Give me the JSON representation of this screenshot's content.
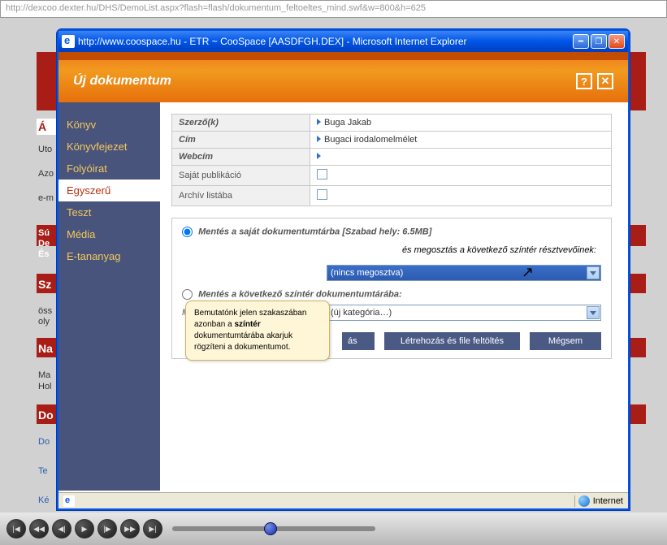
{
  "url_bar": "http://dexcoo.dexter.hu/DHS/DemoList.aspx?flash=flash/dokumentum_feltoeltes_mind.swf&w=800&h=625",
  "bg": {
    "heading1": "Á",
    "nav1": "Uto",
    "nav2": "Azo",
    "nav3": "e-m",
    "red1a": "Sú",
    "red1b": "De",
    "red1c": "És",
    "heading2": "Sz",
    "nav4": "öss",
    "nav5": "oly",
    "heading3": "Na",
    "nav6": "Ma",
    "nav7": "Hol",
    "heading4": "Do",
    "nav8": "Do",
    "nav9": "Te",
    "nav10": "Ké"
  },
  "ie": {
    "title": "http://www.coospace.hu - ETR ~ CooSpace [AASDFGH.DEX] - Microsoft Internet Explorer",
    "status_zone": "Internet"
  },
  "header": {
    "title": "Új dokumentum"
  },
  "sidebar": {
    "items": [
      {
        "label": "Könyv"
      },
      {
        "label": "Könyvfejezet"
      },
      {
        "label": "Folyóirat"
      },
      {
        "label": "Egyszerű"
      },
      {
        "label": "Teszt"
      },
      {
        "label": "Média"
      },
      {
        "label": "E-tananyag"
      }
    ]
  },
  "form": {
    "author_lbl": "Szerző(k)",
    "author_val": "Buga Jakab",
    "title_lbl": "Cím",
    "title_val": "Bugaci irodalomelmélet",
    "url_lbl": "Webcím",
    "url_val": "",
    "own_lbl": "Saját publikáció",
    "archive_lbl": "Archív listába"
  },
  "save": {
    "opt1": "Mentés a saját dokumentumtárba [Szabad hely: 6.5MB]",
    "share_lbl": "és megosztás a következő színtér résztvevőinek:",
    "share_val": "(nincs megosztva)",
    "opt2": "Mentés a következő színtér dokumentumtárába:",
    "cat_lbl": "Megjelenítési kategória:",
    "cat_val": "(új kategória…)"
  },
  "buttons": {
    "create": "Létrehozás",
    "create_hidden_suffix": "ás",
    "create_upload": "Létrehozás és file feltöltés",
    "cancel": "Mégsem"
  },
  "tooltip": {
    "t1": "Bemutatónk jelen szakaszában azonban a ",
    "t2": "színtér",
    "t3": " dokumentumtárába akarjuk rögzíteni a dokumentumot."
  }
}
